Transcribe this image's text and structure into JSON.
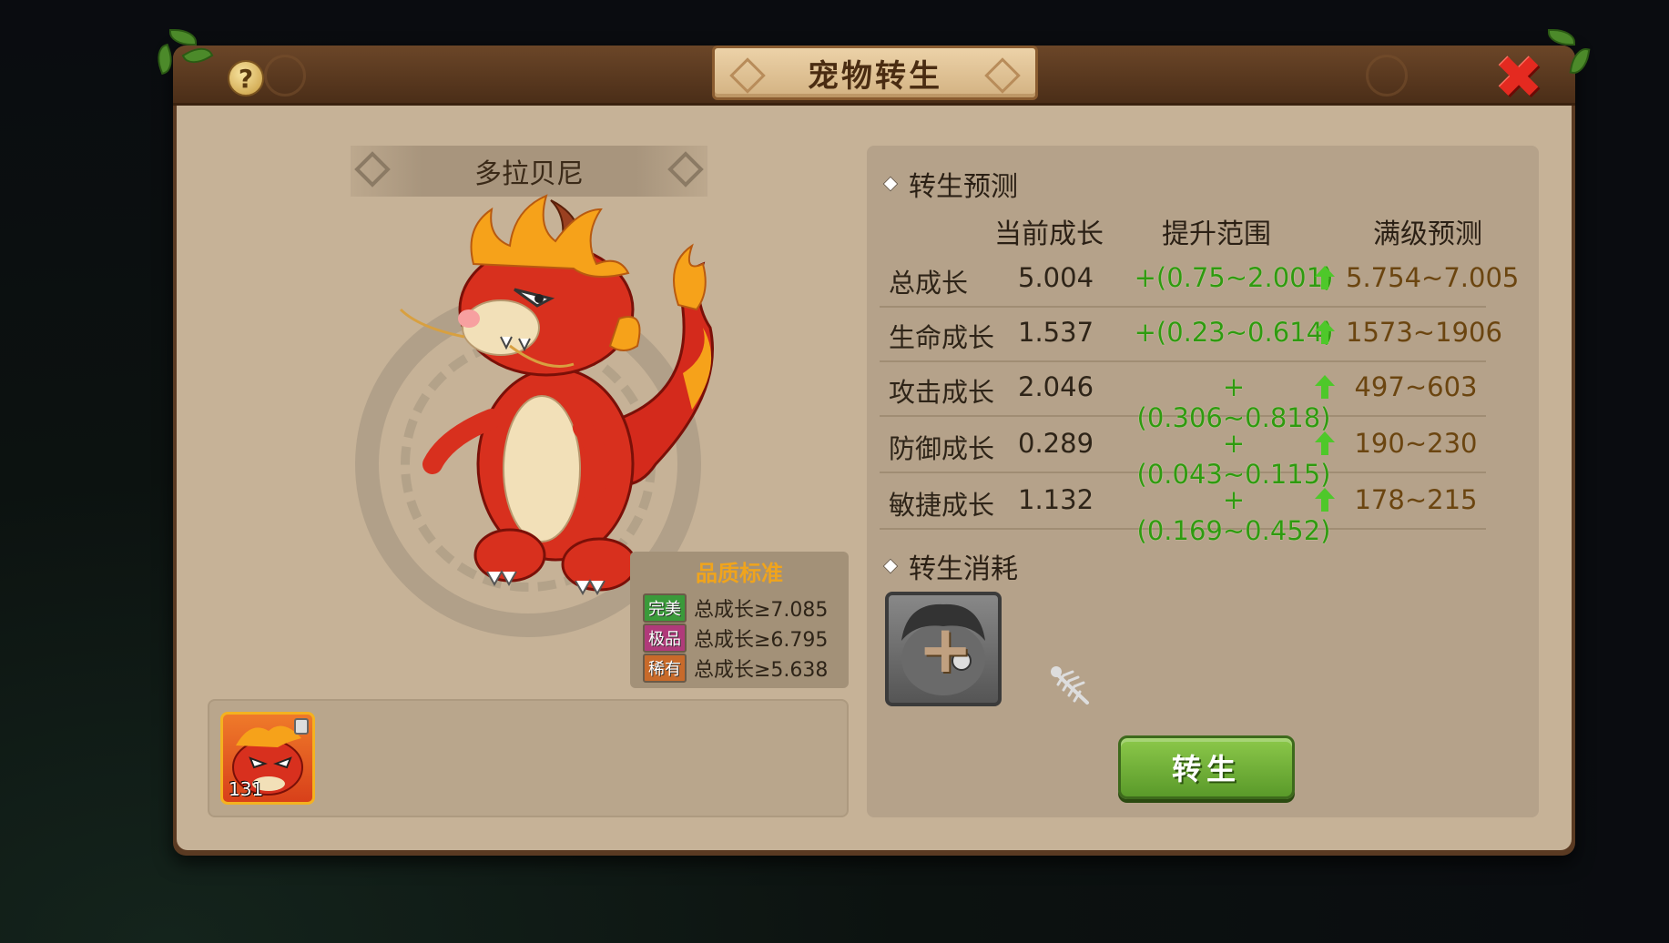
{
  "window": {
    "title": "宠物转生"
  },
  "pet": {
    "name": "多拉贝尼",
    "slot_level": "131"
  },
  "quality_standard": {
    "title": "品质标准",
    "rows": [
      {
        "badge": "完美",
        "badge_color": "#3a9a3a",
        "text": "总成长≥7.085"
      },
      {
        "badge": "极品",
        "badge_color": "#b03a7a",
        "text": "总成长≥6.795"
      },
      {
        "badge": "稀有",
        "badge_color": "#c86a2a",
        "text": "总成长≥5.638"
      }
    ]
  },
  "forecast": {
    "heading": "转生预测",
    "columns": [
      "当前成长",
      "提升范围",
      "满级预测"
    ],
    "rows": [
      {
        "label": "总成长",
        "current": "5.004",
        "range": "+(0.75~2.001)",
        "max": "5.754~7.005"
      },
      {
        "label": "生命成长",
        "current": "1.537",
        "range": "+(0.23~0.614)",
        "max": "1573~1906"
      },
      {
        "label": "攻击成长",
        "current": "2.046",
        "range": "+(0.306~0.818)",
        "max": "497~603"
      },
      {
        "label": "防御成长",
        "current": "0.289",
        "range": "+(0.043~0.115)",
        "max": "190~230"
      },
      {
        "label": "敏捷成长",
        "current": "1.132",
        "range": "+(0.169~0.452)",
        "max": "178~215"
      }
    ]
  },
  "cost": {
    "heading": "转生消耗"
  },
  "action": {
    "rebirth_label": "转生"
  },
  "icons": {
    "help": "question-icon",
    "close": "close-icon",
    "up": "up-arrow-icon",
    "add": "plus-icon",
    "fishbone": "fishbone-icon",
    "lock": "lock-icon"
  },
  "colors": {
    "range_green": "#2f9a10",
    "max_gold": "#6b4510",
    "button_green": "#6fb03a",
    "close_red": "#e42a20"
  }
}
